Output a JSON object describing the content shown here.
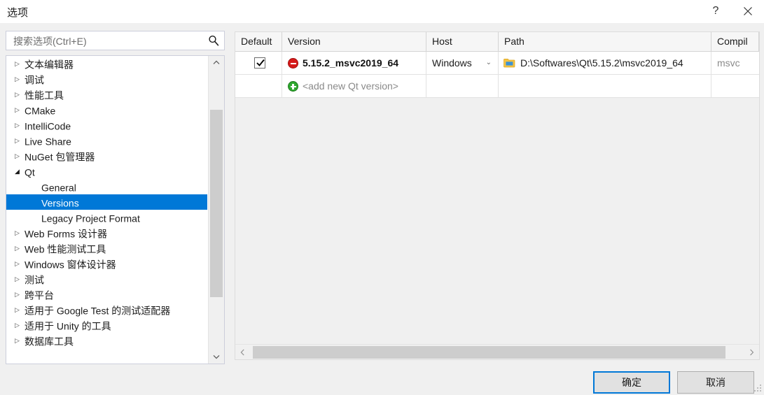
{
  "window": {
    "title": "选项",
    "help_label": "?",
    "close_label": "×"
  },
  "search": {
    "placeholder": "搜索选项(Ctrl+E)",
    "value": "",
    "icon": "search-icon"
  },
  "tree": {
    "items": [
      {
        "label": "文本编辑器",
        "arrow": "▷",
        "level": 0,
        "selected": false
      },
      {
        "label": "调试",
        "arrow": "▷",
        "level": 0,
        "selected": false
      },
      {
        "label": "性能工具",
        "arrow": "▷",
        "level": 0,
        "selected": false
      },
      {
        "label": "CMake",
        "arrow": "▷",
        "level": 0,
        "selected": false
      },
      {
        "label": "IntelliCode",
        "arrow": "▷",
        "level": 0,
        "selected": false
      },
      {
        "label": "Live Share",
        "arrow": "▷",
        "level": 0,
        "selected": false
      },
      {
        "label": "NuGet 包管理器",
        "arrow": "▷",
        "level": 0,
        "selected": false
      },
      {
        "label": "Qt",
        "arrow": "◢",
        "level": 0,
        "selected": false
      },
      {
        "label": "General",
        "arrow": "",
        "level": 1,
        "selected": false
      },
      {
        "label": "Versions",
        "arrow": "",
        "level": 1,
        "selected": true
      },
      {
        "label": "Legacy Project Format",
        "arrow": "",
        "level": 1,
        "selected": false
      },
      {
        "label": "Web Forms 设计器",
        "arrow": "▷",
        "level": 0,
        "selected": false
      },
      {
        "label": "Web 性能测试工具",
        "arrow": "▷",
        "level": 0,
        "selected": false
      },
      {
        "label": "Windows 窗体设计器",
        "arrow": "▷",
        "level": 0,
        "selected": false
      },
      {
        "label": "测试",
        "arrow": "▷",
        "level": 0,
        "selected": false
      },
      {
        "label": "跨平台",
        "arrow": "▷",
        "level": 0,
        "selected": false
      },
      {
        "label": "适用于 Google Test 的测试适配器",
        "arrow": "▷",
        "level": 0,
        "selected": false
      },
      {
        "label": "适用于 Unity 的工具",
        "arrow": "▷",
        "level": 0,
        "selected": false
      },
      {
        "label": "数据库工具",
        "arrow": "▷",
        "level": 0,
        "selected": false
      }
    ],
    "scroll_up_icon": "chevron-up-icon",
    "scroll_down_icon": "chevron-down-icon"
  },
  "grid": {
    "columns": [
      {
        "label": "Default"
      },
      {
        "label": "Version"
      },
      {
        "label": "Host"
      },
      {
        "label": "Path"
      },
      {
        "label": "Compil"
      }
    ],
    "rows": [
      {
        "default_checked": true,
        "status_icon": "remove-circle-icon",
        "version": "5.15.2_msvc2019_64",
        "host": "Windows",
        "host_chevron": "⌄",
        "path_icon": "folder-icon",
        "path": "D:\\Softwares\\Qt\\5.15.2\\msvc2019_64",
        "compiler": "msvc"
      },
      {
        "default_checked": false,
        "status_icon": "add-circle-icon",
        "version": "<add new Qt version>",
        "host": "",
        "host_chevron": "",
        "path_icon": "",
        "path": "",
        "compiler": ""
      }
    ],
    "hscroll_left_icon": "chevron-left-icon",
    "hscroll_right_icon": "chevron-right-icon"
  },
  "footer": {
    "ok_label": "确定",
    "cancel_label": "取消"
  },
  "colors": {
    "selection_blue": "#0078D7",
    "remove_red": "#D61A1A",
    "add_green": "#2FA82F",
    "folder_yellow": "#F5C344",
    "dialog_bg": "#F0F0F0"
  }
}
